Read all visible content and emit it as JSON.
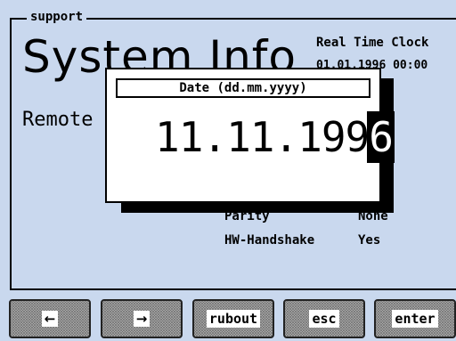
{
  "group": {
    "title": "support"
  },
  "page": {
    "title": "System Info"
  },
  "rtc": {
    "label": "Real Time Clock",
    "value": "01.01.1996 00:00"
  },
  "remote": {
    "label": "Remote"
  },
  "params": [
    {
      "key": "Parity",
      "value": "None"
    },
    {
      "key": "HW-Handshake",
      "value": "Yes"
    }
  ],
  "dialog": {
    "title": "Date (dd.mm.yyyy)",
    "value_main": "11.11.199",
    "value_cursor": "6"
  },
  "softkeys": [
    {
      "label": "",
      "icon": "arrow-left-icon",
      "glyph": "←"
    },
    {
      "label": "",
      "icon": "arrow-right-icon",
      "glyph": "→"
    },
    {
      "label": "rubout"
    },
    {
      "label": "esc"
    },
    {
      "label": "enter"
    }
  ],
  "colors": {
    "screen_bg": "#c9d8ee",
    "dialog_bg": "#ffffff",
    "ink": "#000000"
  }
}
